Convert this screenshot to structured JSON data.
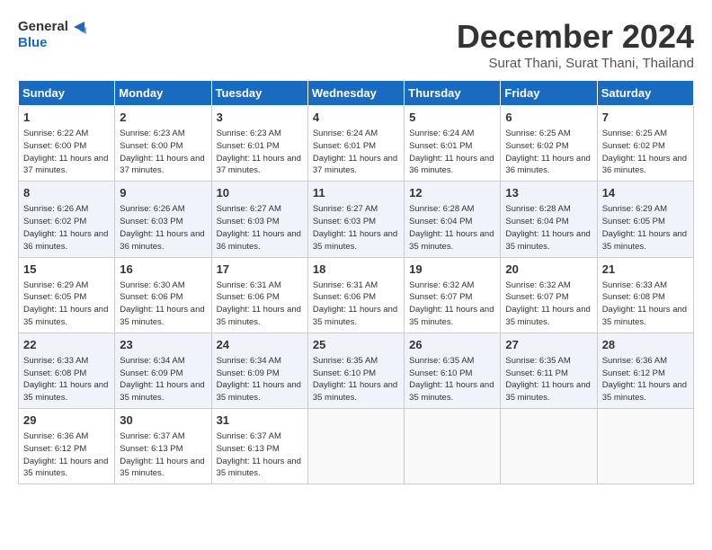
{
  "logo": {
    "text_general": "General",
    "text_blue": "Blue"
  },
  "title": "December 2024",
  "subtitle": "Surat Thani, Surat Thani, Thailand",
  "days_header": [
    "Sunday",
    "Monday",
    "Tuesday",
    "Wednesday",
    "Thursday",
    "Friday",
    "Saturday"
  ],
  "weeks": [
    [
      {
        "day": "1",
        "sunrise": "6:22 AM",
        "sunset": "6:00 PM",
        "daylight": "11 hours and 37 minutes."
      },
      {
        "day": "2",
        "sunrise": "6:23 AM",
        "sunset": "6:00 PM",
        "daylight": "11 hours and 37 minutes."
      },
      {
        "day": "3",
        "sunrise": "6:23 AM",
        "sunset": "6:01 PM",
        "daylight": "11 hours and 37 minutes."
      },
      {
        "day": "4",
        "sunrise": "6:24 AM",
        "sunset": "6:01 PM",
        "daylight": "11 hours and 37 minutes."
      },
      {
        "day": "5",
        "sunrise": "6:24 AM",
        "sunset": "6:01 PM",
        "daylight": "11 hours and 36 minutes."
      },
      {
        "day": "6",
        "sunrise": "6:25 AM",
        "sunset": "6:02 PM",
        "daylight": "11 hours and 36 minutes."
      },
      {
        "day": "7",
        "sunrise": "6:25 AM",
        "sunset": "6:02 PM",
        "daylight": "11 hours and 36 minutes."
      }
    ],
    [
      {
        "day": "8",
        "sunrise": "6:26 AM",
        "sunset": "6:02 PM",
        "daylight": "11 hours and 36 minutes."
      },
      {
        "day": "9",
        "sunrise": "6:26 AM",
        "sunset": "6:03 PM",
        "daylight": "11 hours and 36 minutes."
      },
      {
        "day": "10",
        "sunrise": "6:27 AM",
        "sunset": "6:03 PM",
        "daylight": "11 hours and 36 minutes."
      },
      {
        "day": "11",
        "sunrise": "6:27 AM",
        "sunset": "6:03 PM",
        "daylight": "11 hours and 35 minutes."
      },
      {
        "day": "12",
        "sunrise": "6:28 AM",
        "sunset": "6:04 PM",
        "daylight": "11 hours and 35 minutes."
      },
      {
        "day": "13",
        "sunrise": "6:28 AM",
        "sunset": "6:04 PM",
        "daylight": "11 hours and 35 minutes."
      },
      {
        "day": "14",
        "sunrise": "6:29 AM",
        "sunset": "6:05 PM",
        "daylight": "11 hours and 35 minutes."
      }
    ],
    [
      {
        "day": "15",
        "sunrise": "6:29 AM",
        "sunset": "6:05 PM",
        "daylight": "11 hours and 35 minutes."
      },
      {
        "day": "16",
        "sunrise": "6:30 AM",
        "sunset": "6:06 PM",
        "daylight": "11 hours and 35 minutes."
      },
      {
        "day": "17",
        "sunrise": "6:31 AM",
        "sunset": "6:06 PM",
        "daylight": "11 hours and 35 minutes."
      },
      {
        "day": "18",
        "sunrise": "6:31 AM",
        "sunset": "6:06 PM",
        "daylight": "11 hours and 35 minutes."
      },
      {
        "day": "19",
        "sunrise": "6:32 AM",
        "sunset": "6:07 PM",
        "daylight": "11 hours and 35 minutes."
      },
      {
        "day": "20",
        "sunrise": "6:32 AM",
        "sunset": "6:07 PM",
        "daylight": "11 hours and 35 minutes."
      },
      {
        "day": "21",
        "sunrise": "6:33 AM",
        "sunset": "6:08 PM",
        "daylight": "11 hours and 35 minutes."
      }
    ],
    [
      {
        "day": "22",
        "sunrise": "6:33 AM",
        "sunset": "6:08 PM",
        "daylight": "11 hours and 35 minutes."
      },
      {
        "day": "23",
        "sunrise": "6:34 AM",
        "sunset": "6:09 PM",
        "daylight": "11 hours and 35 minutes."
      },
      {
        "day": "24",
        "sunrise": "6:34 AM",
        "sunset": "6:09 PM",
        "daylight": "11 hours and 35 minutes."
      },
      {
        "day": "25",
        "sunrise": "6:35 AM",
        "sunset": "6:10 PM",
        "daylight": "11 hours and 35 minutes."
      },
      {
        "day": "26",
        "sunrise": "6:35 AM",
        "sunset": "6:10 PM",
        "daylight": "11 hours and 35 minutes."
      },
      {
        "day": "27",
        "sunrise": "6:35 AM",
        "sunset": "6:11 PM",
        "daylight": "11 hours and 35 minutes."
      },
      {
        "day": "28",
        "sunrise": "6:36 AM",
        "sunset": "6:12 PM",
        "daylight": "11 hours and 35 minutes."
      }
    ],
    [
      {
        "day": "29",
        "sunrise": "6:36 AM",
        "sunset": "6:12 PM",
        "daylight": "11 hours and 35 minutes."
      },
      {
        "day": "30",
        "sunrise": "6:37 AM",
        "sunset": "6:13 PM",
        "daylight": "11 hours and 35 minutes."
      },
      {
        "day": "31",
        "sunrise": "6:37 AM",
        "sunset": "6:13 PM",
        "daylight": "11 hours and 35 minutes."
      },
      null,
      null,
      null,
      null
    ]
  ]
}
